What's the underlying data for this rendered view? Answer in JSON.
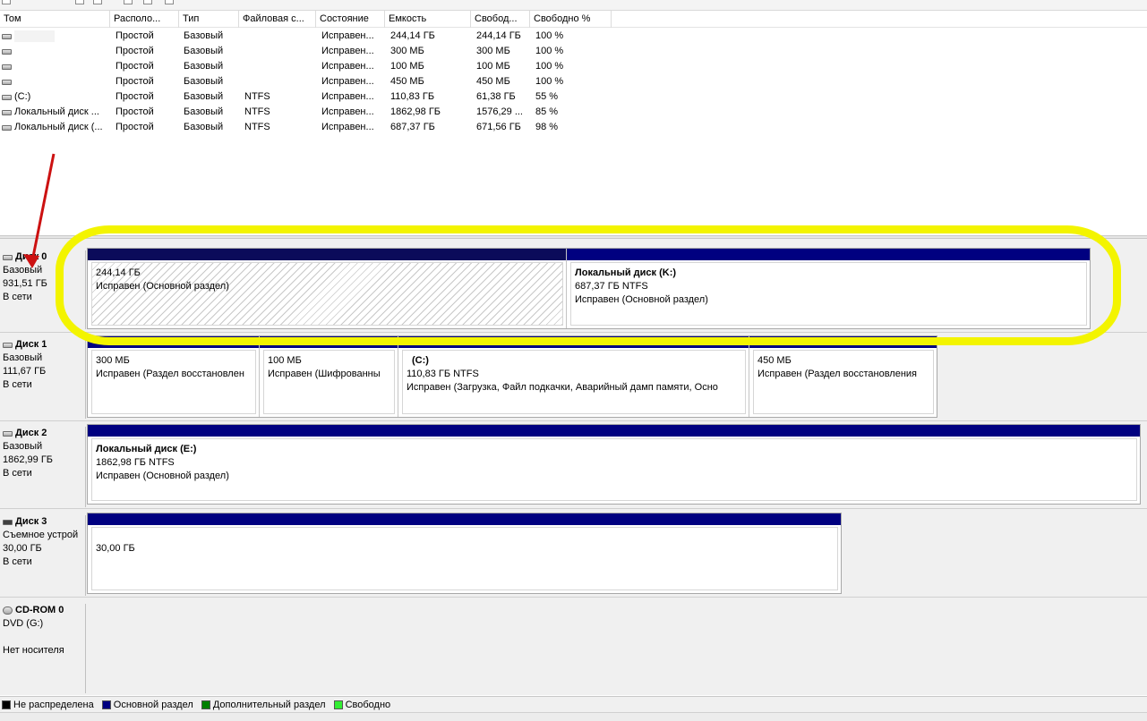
{
  "columns": [
    "Том",
    "Располо...",
    "Тип",
    "Файловая с...",
    "Состояние",
    "Емкость",
    "Свобод...",
    "Свободно %"
  ],
  "volumes": [
    {
      "name": "",
      "layout": "Простой",
      "type": "Базовый",
      "fs": "",
      "status": "Исправен...",
      "capacity": "244,14 ГБ",
      "free": "244,14 ГБ",
      "free_pct": "100 %"
    },
    {
      "name": "",
      "layout": "Простой",
      "type": "Базовый",
      "fs": "",
      "status": "Исправен...",
      "capacity": "300 МБ",
      "free": "300 МБ",
      "free_pct": "100 %"
    },
    {
      "name": "",
      "layout": "Простой",
      "type": "Базовый",
      "fs": "",
      "status": "Исправен...",
      "capacity": "100 МБ",
      "free": "100 МБ",
      "free_pct": "100 %"
    },
    {
      "name": "",
      "layout": "Простой",
      "type": "Базовый",
      "fs": "",
      "status": "Исправен...",
      "capacity": "450 МБ",
      "free": "450 МБ",
      "free_pct": "100 %"
    },
    {
      "name": "(C:)",
      "layout": "Простой",
      "type": "Базовый",
      "fs": "NTFS",
      "status": "Исправен...",
      "capacity": "110,83 ГБ",
      "free": "61,38 ГБ",
      "free_pct": "55 %"
    },
    {
      "name": "Локальный диск ...",
      "layout": "Простой",
      "type": "Базовый",
      "fs": "NTFS",
      "status": "Исправен...",
      "capacity": "1862,98 ГБ",
      "free": "1576,29 ...",
      "free_pct": "85 %"
    },
    {
      "name": "Локальный диск (...",
      "layout": "Простой",
      "type": "Базовый",
      "fs": "NTFS",
      "status": "Исправен...",
      "capacity": "687,37 ГБ",
      "free": "671,56 ГБ",
      "free_pct": "98 %"
    }
  ],
  "disks": [
    {
      "title": "Диск 0",
      "kind": "Базовый",
      "size": "931,51 ГБ",
      "state": "В сети",
      "partitions": [
        {
          "title": "",
          "size": "244,14 ГБ",
          "status": "Исправен (Основной раздел)",
          "hatched": true
        },
        {
          "title": "Локальный диск  (K:)",
          "size": "687,37 ГБ NTFS",
          "status": "Исправен (Основной раздел)",
          "hatched": false
        }
      ]
    },
    {
      "title": "Диск 1",
      "kind": "Базовый",
      "size": "111,67 ГБ",
      "state": "В сети",
      "partitions": [
        {
          "title": "",
          "size": "300 МБ",
          "status": "Исправен (Раздел восстановлен"
        },
        {
          "title": "",
          "size": "100 МБ",
          "status": "Исправен (Шифрованны"
        },
        {
          "title": "(C:)",
          "size": "110,83 ГБ NTFS",
          "status": "Исправен (Загрузка, Файл подкачки, Аварийный дамп памяти, Осно"
        },
        {
          "title": "",
          "size": "450 МБ",
          "status": "Исправен (Раздел восстановления"
        }
      ]
    },
    {
      "title": "Диск 2",
      "kind": "Базовый",
      "size": "1862,99 ГБ",
      "state": "В сети",
      "partitions": [
        {
          "title": "Локальный диск  (E:)",
          "size": "1862,98 ГБ NTFS",
          "status": "Исправен (Основной раздел)"
        }
      ]
    },
    {
      "title": "Диск 3",
      "kind": "Съемное устрой",
      "size": "30,00 ГБ",
      "state": "В сети",
      "partitions": [
        {
          "title": "",
          "size": "30,00 ГБ",
          "status": ""
        }
      ]
    },
    {
      "title": "CD-ROM 0",
      "kind": "DVD (G:)",
      "size": "",
      "state": "Нет носителя"
    }
  ],
  "legend": [
    {
      "label": "Не распределена",
      "color": "#000000"
    },
    {
      "label": "Основной раздел",
      "color": "#000080"
    },
    {
      "label": "Дополнительный раздел",
      "color": "#008000"
    },
    {
      "label": "Свободно",
      "color": "#33ee33"
    }
  ],
  "colors": {
    "primary_partition": "#000080",
    "highlight": "#f3f400",
    "arrow": "#cc1111"
  }
}
